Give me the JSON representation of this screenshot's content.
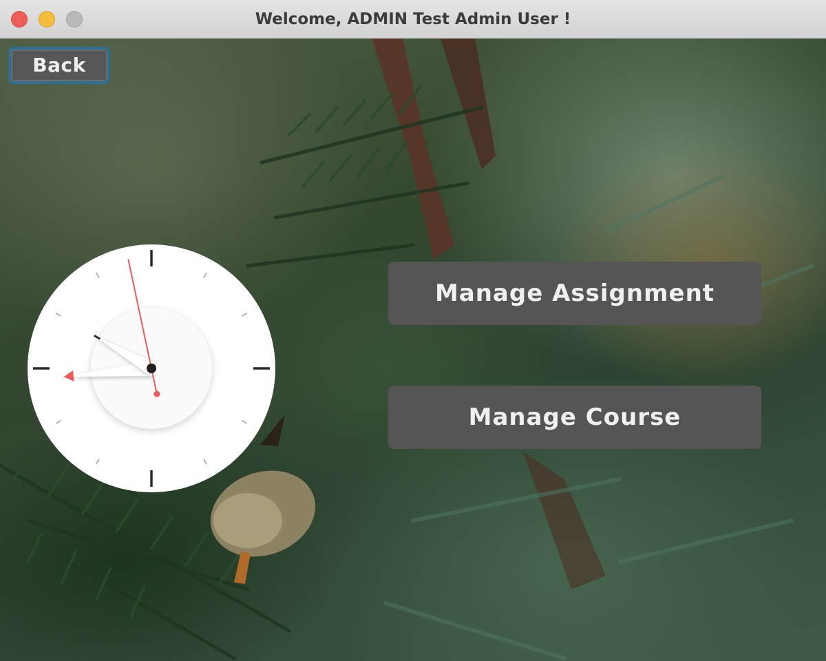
{
  "window": {
    "title": "Welcome, ADMIN Test Admin User !"
  },
  "toolbar": {
    "back_label": "Back"
  },
  "actions": {
    "manage_assignment": "Manage Assignment",
    "manage_course": "Manage Course"
  },
  "clock": {
    "hour": 8,
    "minute": 49,
    "second": 58,
    "face_color": "#ffffff",
    "second_hand_color": "#ee5a5a",
    "tick_color": "#2a2a2a"
  },
  "colors": {
    "button_bg": "#555555",
    "button_text": "#f0f0f0",
    "focus_ring": "#2f6f95"
  }
}
